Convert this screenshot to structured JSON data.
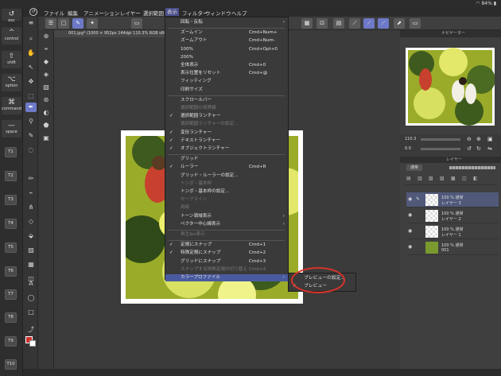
{
  "status_bar": {
    "battery": "84%"
  },
  "menu_bar": {
    "items": [
      "ファイル",
      "編集",
      "アニメーション",
      "レイヤー",
      "選択範囲",
      "表示",
      "フィルター",
      "ウィンドウ",
      "ヘルプ"
    ]
  },
  "modifiers": {
    "esc": "esc",
    "control": "control",
    "shift": "shift",
    "option": "option",
    "command": "command",
    "space": "space"
  },
  "t_keys": [
    "T1",
    "T2",
    "T3",
    "T4",
    "T5",
    "T6",
    "T7",
    "T8",
    "T9",
    "T10"
  ],
  "canvas_info": "001.jpg* (1000 × 952px 144dpi 110.3%  RGB sRGB IEC61",
  "view_menu": {
    "items": [
      {
        "label": "回転・反転",
        "shortcut": "",
        "check": false,
        "disabled": false,
        "submenu": true
      },
      {
        "label": "ズームイン",
        "shortcut": "Cmd+Num+",
        "check": false,
        "disabled": false,
        "submenu": false
      },
      {
        "label": "ズームアウト",
        "shortcut": "Cmd+Num-",
        "check": false,
        "disabled": false,
        "submenu": false
      },
      {
        "label": "100%",
        "shortcut": "Cmd+Opt+0",
        "check": false,
        "disabled": false,
        "submenu": false
      },
      {
        "label": "200%",
        "shortcut": "",
        "check": false,
        "disabled": false,
        "submenu": false
      },
      {
        "label": "全体表示",
        "shortcut": "Cmd+0",
        "check": false,
        "disabled": false,
        "submenu": false
      },
      {
        "label": "表示位置をリセット",
        "shortcut": "Cmd+@",
        "check": false,
        "disabled": false,
        "submenu": false
      },
      {
        "label": "フィッティング",
        "shortcut": "",
        "check": false,
        "disabled": false,
        "submenu": false
      },
      {
        "label": "印刷サイズ",
        "shortcut": "",
        "check": false,
        "disabled": false,
        "submenu": false
      },
      {
        "label": "スクロールバー",
        "shortcut": "",
        "check": false,
        "disabled": false,
        "submenu": false
      },
      {
        "label": "選択範囲の境界線",
        "shortcut": "",
        "check": false,
        "disabled": true,
        "submenu": false
      },
      {
        "label": "選択範囲ランチャー",
        "shortcut": "",
        "check": true,
        "disabled": false,
        "submenu": false
      },
      {
        "label": "選択範囲ランチャーの設定...",
        "shortcut": "",
        "check": false,
        "disabled": true,
        "submenu": false
      },
      {
        "label": "変形ランチャー",
        "shortcut": "",
        "check": true,
        "disabled": false,
        "submenu": false
      },
      {
        "label": "テキストランチャー",
        "shortcut": "",
        "check": true,
        "disabled": false,
        "submenu": false
      },
      {
        "label": "オブジェクトランチャー",
        "shortcut": "",
        "check": true,
        "disabled": false,
        "submenu": false
      },
      {
        "label": "グリッド",
        "shortcut": "",
        "check": false,
        "disabled": false,
        "submenu": false
      },
      {
        "label": "ルーラー",
        "shortcut": "Cmd+R",
        "check": true,
        "disabled": false,
        "submenu": false
      },
      {
        "label": "グリッド・ルーラーの設定...",
        "shortcut": "",
        "check": false,
        "disabled": false,
        "submenu": false
      },
      {
        "label": "トンボ・基本枠",
        "shortcut": "",
        "check": false,
        "disabled": true,
        "submenu": false
      },
      {
        "label": "トンボ・基本枠の設定...",
        "shortcut": "",
        "check": false,
        "disabled": false,
        "submenu": false
      },
      {
        "label": "セーフライン",
        "shortcut": "",
        "check": false,
        "disabled": true,
        "submenu": false
      },
      {
        "label": "用紙",
        "shortcut": "",
        "check": false,
        "disabled": true,
        "submenu": false
      },
      {
        "label": "トーン領域表示",
        "shortcut": "",
        "check": false,
        "disabled": false,
        "submenu": true
      },
      {
        "label": "ベクター中心線表示",
        "shortcut": "",
        "check": false,
        "disabled": false,
        "submenu": true
      },
      {
        "label": "再生fps表示",
        "shortcut": "",
        "check": false,
        "disabled": true,
        "submenu": false
      },
      {
        "label": "定規にスナップ",
        "shortcut": "Cmd+1",
        "check": true,
        "disabled": false,
        "submenu": false
      },
      {
        "label": "特殊定規にスナップ",
        "shortcut": "Cmd+2",
        "check": true,
        "disabled": false,
        "submenu": false
      },
      {
        "label": "グリッドにスナップ",
        "shortcut": "Cmd+3",
        "check": false,
        "disabled": false,
        "submenu": false
      },
      {
        "label": "スナップする特殊定規の切り替え",
        "shortcut": "Cmd+4",
        "check": false,
        "disabled": true,
        "submenu": false
      },
      {
        "label": "カラープロファイル",
        "shortcut": "",
        "check": false,
        "disabled": false,
        "submenu": true,
        "highlighted": true
      }
    ]
  },
  "color_profile_submenu": {
    "items": [
      {
        "label": "プレビューの設定...",
        "check": false
      },
      {
        "label": "プレビュー",
        "check": true
      }
    ]
  },
  "navigator": {
    "title": "ナビゲーター",
    "zoom": "110.3",
    "angle": "0.0"
  },
  "layers": {
    "title": "レイヤー",
    "blend_mode": "通常",
    "items": [
      {
        "opacity": "100 % 通常",
        "name": "レイヤー 3",
        "selected": true
      },
      {
        "opacity": "100 % 通常",
        "name": "レイヤー 2",
        "selected": false
      },
      {
        "opacity": "100 % 通常",
        "name": "レイヤー 1",
        "selected": false
      },
      {
        "opacity": "100 % 通常",
        "name": "001",
        "selected": false
      }
    ]
  },
  "colors": {
    "accent": "#6d79c7",
    "menu_highlight": "#4a5aa0",
    "annotation": "#d9332a"
  }
}
